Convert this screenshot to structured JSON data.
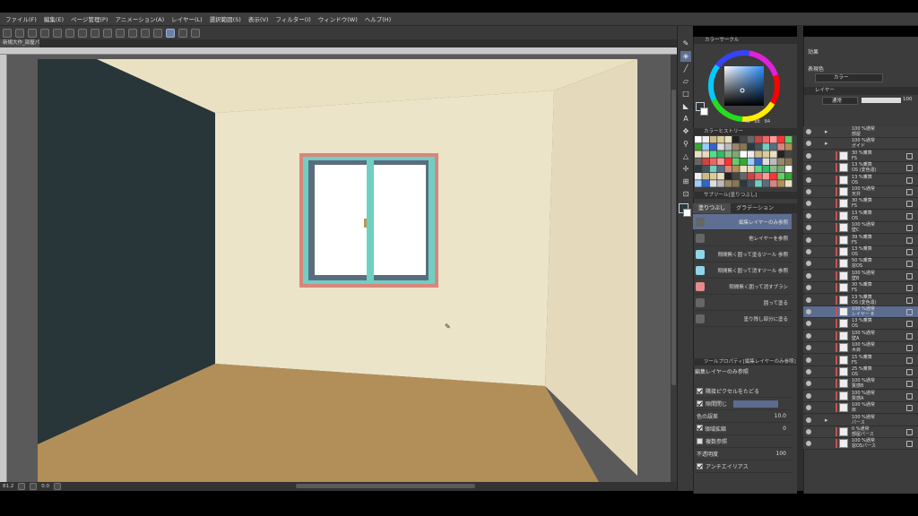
{
  "menu": [
    "ファイル(F)",
    "編集(E)",
    "ページ管理(P)",
    "アニメーション(A)",
    "レイヤー(L)",
    "選択範囲(S)",
    "表示(V)",
    "フィルター(I)",
    "ウィンドウ(W)",
    "ヘルプ(H)"
  ],
  "document_tab": "新規大作_部屋パ...",
  "status": {
    "zoom": "81.2",
    "angle": "0.0"
  },
  "color_panel": {
    "wheel_title": "カラーサークル",
    "values": [
      "43",
      "88",
      "84"
    ],
    "history_title": "カラーヒストリー",
    "subtool_title": "サブツール[塗りつぶし]",
    "tabs": [
      "塗りつぶし",
      "グラデーション"
    ],
    "fill_items": [
      "編集レイヤーのみ参照",
      "他レイヤーを参照",
      "隙間無く囲って塗るツール 参照",
      "隙間無く囲って消すツール 参照",
      "隙間無く囲って消すブラシ",
      "囲って塗る",
      "塗り残し部分に塗る"
    ],
    "tool_property_title": "ツールプロパティ[編集レイヤーのみ参照]",
    "tool_property_name": "編集レイヤーのみ参照",
    "props": {
      "adjacent": "隣接ピクセルをたどる",
      "gap_close": "隙間閉じ",
      "color_margin": "色の誤差",
      "color_margin_value": "10.0",
      "area_scaling": "領域拡縮",
      "area_scaling_value": "0",
      "multi_ref": "複数参照",
      "opacity": "不透明度",
      "opacity_value": "100",
      "antialias": "アンチエイリアス"
    }
  },
  "right_panel": {
    "effect_label": "効果",
    "display_color_label": "表現色",
    "display_color_value": "カラー",
    "layer_tab": "レイヤー",
    "blend_mode": "通常",
    "opacity": "100"
  },
  "layers": [
    {
      "t1": "100 %通常",
      "t2": "部屋",
      "type": "folder"
    },
    {
      "t1": "100 %通常",
      "t2": "ガイド",
      "type": "folder"
    },
    {
      "t1": "30 %乗算",
      "t2": "FS",
      "type": "layer"
    },
    {
      "t1": "13 %乗算",
      "t2": "OS (変色違)",
      "type": "layer"
    },
    {
      "t1": "13 %乗算",
      "t2": "OS",
      "type": "layer"
    },
    {
      "t1": "100 %通常",
      "t2": "天井",
      "type": "layer"
    },
    {
      "t1": "30 %乗算",
      "t2": "FS",
      "type": "layer"
    },
    {
      "t1": "13 %乗算",
      "t2": "OS",
      "type": "layer"
    },
    {
      "t1": "100 %通常",
      "t2": "壁C",
      "type": "layer"
    },
    {
      "t1": "39 %乗算",
      "t2": "FS",
      "type": "layer"
    },
    {
      "t1": "13 %乗算",
      "t2": "OS",
      "type": "layer"
    },
    {
      "t1": "50 %乗算",
      "t2": "窓OS",
      "type": "layer"
    },
    {
      "t1": "100 %通常",
      "t2": "壁B",
      "type": "layer"
    },
    {
      "t1": "30 %乗算",
      "t2": "FS",
      "type": "layer"
    },
    {
      "t1": "13 %乗算",
      "t2": "OS (変色違)",
      "type": "layer"
    },
    {
      "t1": "100 %通常",
      "t2": "レイヤー 8",
      "type": "layer",
      "selected": true
    },
    {
      "t1": "13 %乗算",
      "t2": "OS",
      "type": "layer"
    },
    {
      "t1": "100 %通常",
      "t2": "壁A",
      "type": "layer"
    },
    {
      "t1": "100 %通常",
      "t2": "木目",
      "type": "layer"
    },
    {
      "t1": "15 %乗算",
      "t2": "FS",
      "type": "layer"
    },
    {
      "t1": "25 %乗算",
      "t2": "OS",
      "type": "layer"
    },
    {
      "t1": "100 %通常",
      "t2": "質感B",
      "type": "layer"
    },
    {
      "t1": "100 %通常",
      "t2": "質感A",
      "type": "layer"
    },
    {
      "t1": "100 %通常",
      "t2": "床",
      "type": "layer"
    },
    {
      "t1": "100 %通常",
      "t2": "パース",
      "type": "folder"
    },
    {
      "t1": "0 %通常",
      "t2": "部屋パース",
      "type": "layer"
    },
    {
      "t1": "100 %通常",
      "t2": "窓OSパース",
      "type": "layer"
    }
  ],
  "colors": {
    "main": "#2b3840",
    "sub": "#ffffff",
    "accent": "#5c6c8f"
  }
}
